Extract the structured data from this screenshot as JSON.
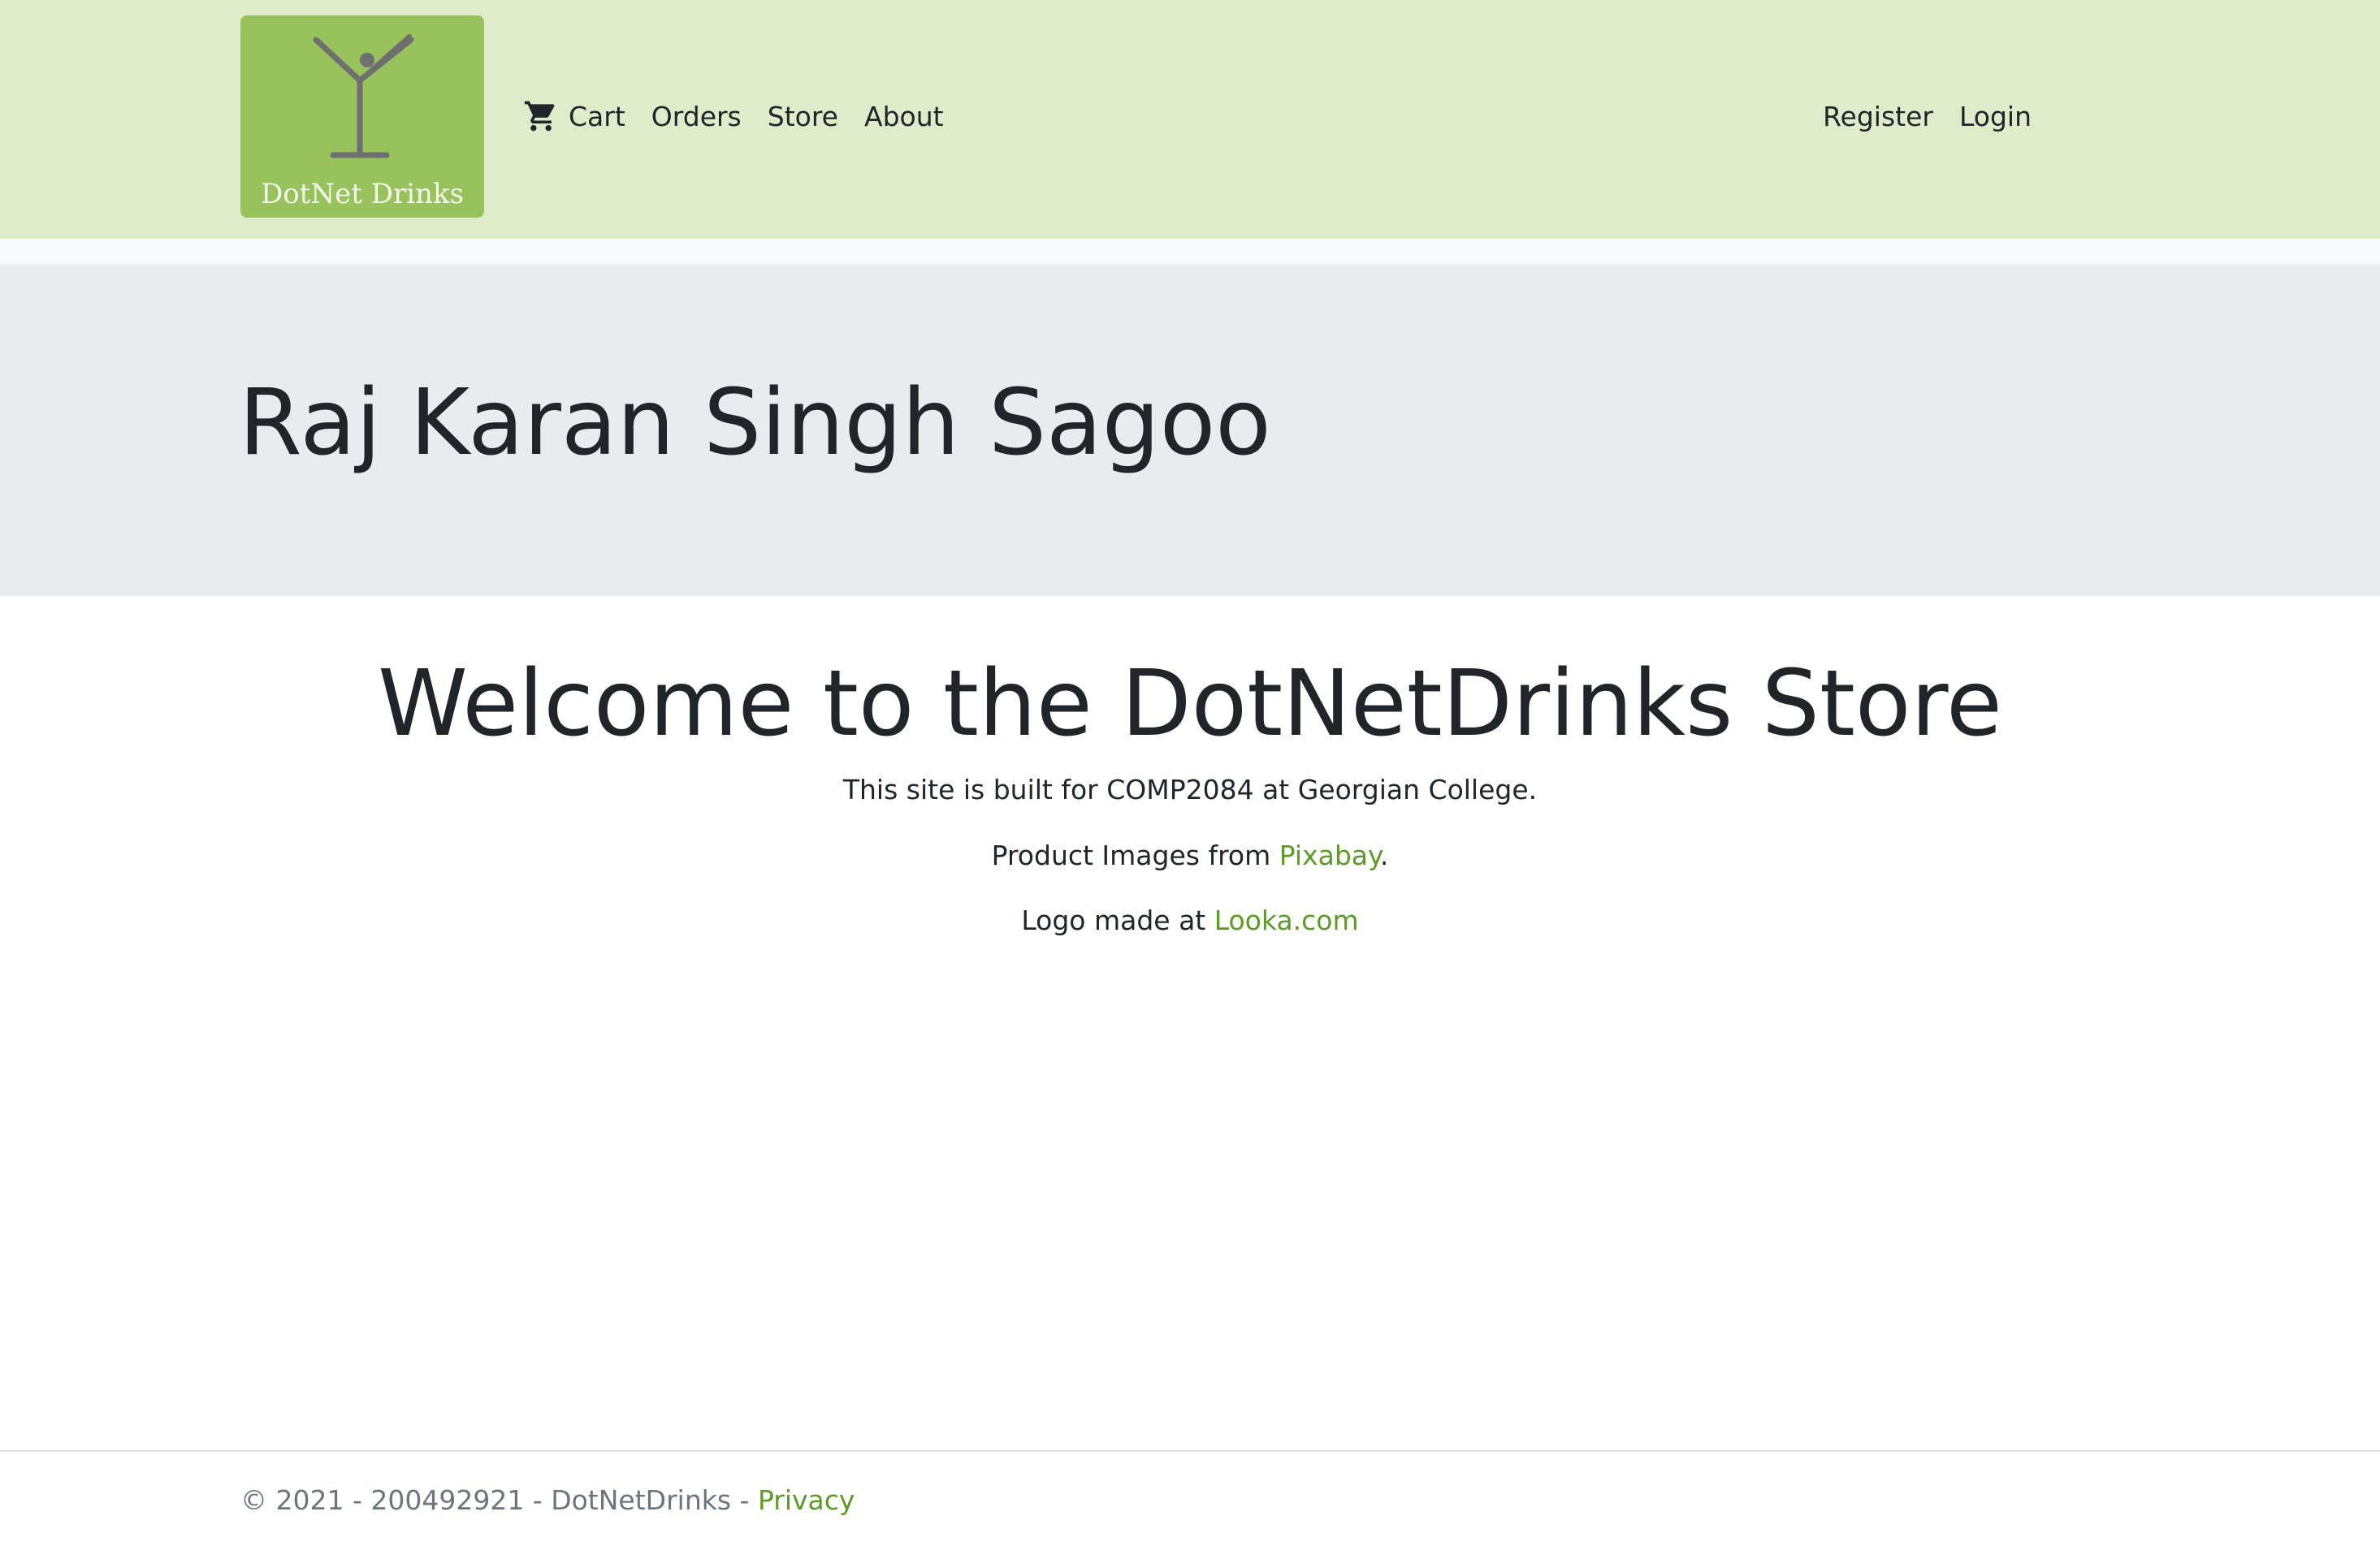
{
  "navbar": {
    "logo_text": "DotNet Drinks",
    "left_links": [
      {
        "label": "Cart",
        "icon": "cart-icon"
      },
      {
        "label": "Orders"
      },
      {
        "label": "Store"
      },
      {
        "label": "About"
      }
    ],
    "right_links": [
      {
        "label": "Register"
      },
      {
        "label": "Login"
      }
    ]
  },
  "jumbotron": {
    "title": "Raj Karan Singh Sagoo"
  },
  "main": {
    "heading": "Welcome to the DotNetDrinks Store",
    "line1": "This site is built for COMP2084 at Georgian College.",
    "line2_prefix": "Product Images from ",
    "line2_link": "Pixabay",
    "line2_suffix": ".",
    "line3_prefix": "Logo made at ",
    "line3_link": "Looka.com"
  },
  "footer": {
    "text": "© 2021 - 200492921 - DotNetDrinks - ",
    "privacy_link": "Privacy"
  },
  "colors": {
    "navbar_bg": "#dfecca",
    "logo_bg": "#98c25b",
    "jumbotron_bg": "#e9ecef",
    "link_green": "#5e9a2a",
    "footer_text": "#6c757d"
  }
}
